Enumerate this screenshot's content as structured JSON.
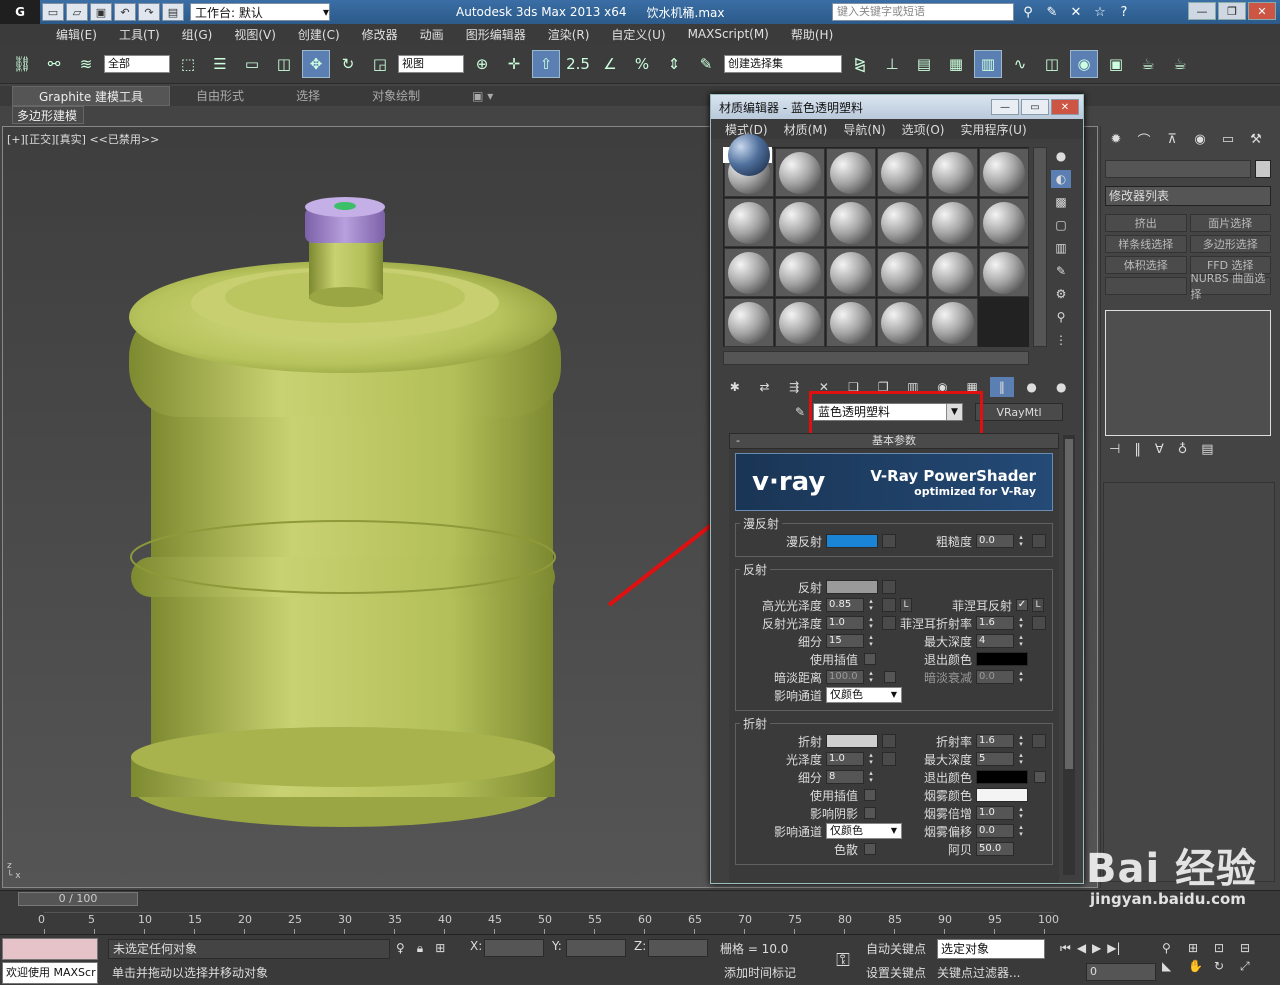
{
  "titlebar": {
    "app_logo": "G",
    "workspace_label": "工作台: 默认",
    "app_name": "Autodesk 3ds Max  2013 x64",
    "file_name": "饮水机桶.max",
    "search_placeholder": "键入关键字或短语",
    "icons": [
      "binoculars-icon",
      "star-icon",
      "help-icon"
    ]
  },
  "menubar": {
    "items": [
      "编辑(E)",
      "工具(T)",
      "组(G)",
      "视图(V)",
      "创建(C)",
      "修改器",
      "动画",
      "图形编辑器",
      "渲染(R)",
      "自定义(U)",
      "MAXScript(M)",
      "帮助(H)"
    ]
  },
  "toolbar": {
    "selection_filter": "全部",
    "reference_coord": "视图",
    "snap_angle_label": "2.5",
    "named_selection": "创建选择集"
  },
  "ribbon": {
    "tabs": [
      "Graphite 建模工具",
      "自由形式",
      "选择",
      "对象绘制"
    ],
    "active_tab": "Graphite 建模工具",
    "sub_label": "多边形建模"
  },
  "viewport": {
    "label": "[+][正交][真实] <<已禁用>>",
    "object_color": "#b7c35c",
    "cap_color": "#a98fcf"
  },
  "command_panel": {
    "modifier_list": "修改器列表",
    "buttons": [
      "挤出",
      "面片选择",
      "样条线选择",
      "多边形选择",
      "体积选择",
      "FFD 选择",
      "",
      "NURBS 曲面选择"
    ]
  },
  "material_editor": {
    "title": "材质编辑器 - 蓝色透明塑料",
    "menu": [
      "模式(D)",
      "材质(M)",
      "导航(N)",
      "选项(O)",
      "实用程序(U)"
    ],
    "material_name": "蓝色透明塑料",
    "material_type": "VRayMtl",
    "rollout_title": "基本参数",
    "banner_logo": "v·ray",
    "banner_title": "V-Ray PowerShader",
    "banner_subtitle": "optimized for V-Ray",
    "diffuse_group": {
      "title": "漫反射",
      "diffuse_label": "漫反射",
      "diffuse_color": "#1a84d6",
      "roughness_label": "粗糙度",
      "roughness_value": "0.0"
    },
    "reflection_group": {
      "title": "反射",
      "reflect_label": "反射",
      "reflect_color": "#9a9a9a",
      "hilight_gloss_label": "高光光泽度",
      "hilight_gloss_value": "0.85",
      "lock_label": "L",
      "fresnel_label": "菲涅耳反射",
      "fresnel_checked": "✓",
      "refl_gloss_label": "反射光泽度",
      "refl_gloss_value": "1.0",
      "fresnel_ior_label": "菲涅耳折射率",
      "fresnel_ior_value": "1.6",
      "subdivs_label": "细分",
      "subdivs_value": "15",
      "max_depth_label": "最大深度",
      "max_depth_value": "4",
      "use_interp_label": "使用插值",
      "exit_color_label": "退出颜色",
      "exit_color": "#000000",
      "dim_dist_label": "暗淡距离",
      "dim_dist_value": "100.0",
      "dim_falloff_label": "暗淡衰减",
      "dim_falloff_value": "0.0",
      "affect_channels_label": "影响通道",
      "affect_channels_value": "仅颜色"
    },
    "refraction_group": {
      "title": "折射",
      "refract_label": "折射",
      "refract_color": "#cfcfcf",
      "ior_label": "折射率",
      "ior_value": "1.6",
      "gloss_label": "光泽度",
      "gloss_value": "1.0",
      "max_depth_label": "最大深度",
      "max_depth_value": "5",
      "subdivs_label": "细分",
      "subdivs_value": "8",
      "exit_color_label": "退出颜色",
      "exit_color": "#000000",
      "use_interp_label": "使用插值",
      "fog_color_label": "烟雾颜色",
      "fog_color": "#f4f4f4",
      "affect_shadows_label": "影响阴影",
      "fog_mult_label": "烟雾倍增",
      "fog_mult_value": "1.0",
      "affect_channels_label": "影响通道",
      "affect_channels_value": "仅颜色",
      "fog_bias_label": "烟雾偏移",
      "fog_bias_value": "0.0",
      "dispersion_label": "色散",
      "abbe_label": "阿贝",
      "abbe_value": "50.0"
    }
  },
  "timeslider": {
    "frame_label": "0 / 100",
    "ticks": [
      "0",
      "5",
      "10",
      "15",
      "20",
      "25",
      "30",
      "35",
      "40",
      "45",
      "50",
      "55",
      "60",
      "65",
      "70",
      "75",
      "80",
      "85",
      "90",
      "95",
      "100"
    ]
  },
  "statusbar": {
    "welcome": "欢迎使用 MAXScr",
    "status_selection": "未选定任何对象",
    "status_prompt": "单击并拖动以选择并移动对象",
    "x_label": "X:",
    "y_label": "Y:",
    "z_label": "Z:",
    "grid_label": "栅格 = 10.0",
    "add_time_tag": "添加时间标记",
    "auto_key": "自动关键点",
    "set_key": "设置关键点",
    "selected_object": "选定对象",
    "key_filters": "关键点过滤器...",
    "frame_value": "0"
  },
  "watermark": {
    "brand": "Bai 经验",
    "url": "jingyan.baidu.com"
  },
  "annotation_color": "#e01010"
}
